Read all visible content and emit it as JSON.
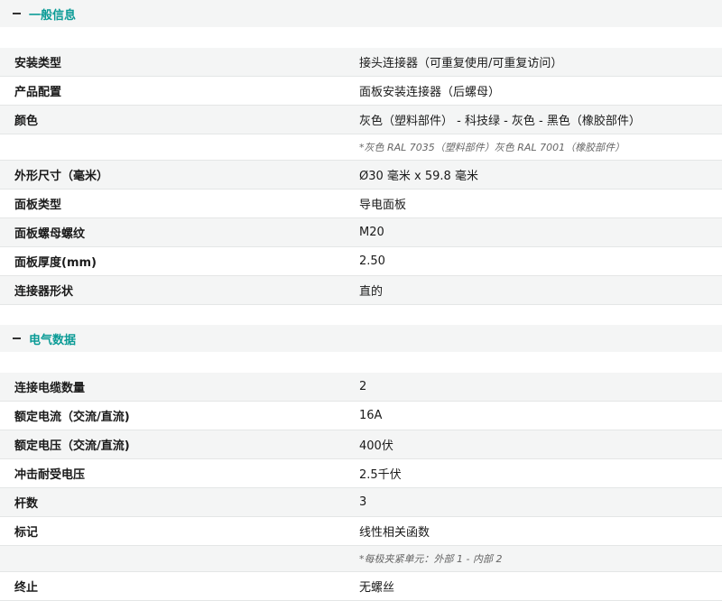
{
  "general": {
    "title": "一般信息",
    "rows": [
      {
        "label": "安装类型",
        "value": "接头连接器（可重复使用/可重复访问）"
      },
      {
        "label": "产品配置",
        "value": "面板安装连接器（后螺母）"
      },
      {
        "label": "颜色",
        "value": "灰色（塑料部件） - 科技绿 - 灰色 - 黑色（橡胶部件）"
      },
      {
        "label": "",
        "value": "*灰色 RAL 7035（塑料部件）灰色 RAL 7001（橡胶部件）"
      },
      {
        "label": "外形尺寸（毫米）",
        "value": "Ø30 毫米 x 59.8 毫米"
      },
      {
        "label": "面板类型",
        "value": "导电面板"
      },
      {
        "label": "面板螺母螺纹",
        "value": "M20"
      },
      {
        "label": "面板厚度(mm)",
        "value": "2.50"
      },
      {
        "label": "连接器形状",
        "value": "直的"
      }
    ]
  },
  "electrical": {
    "title": "电气数据",
    "rows": [
      {
        "label": "连接电缆数量",
        "value": "2"
      },
      {
        "label": "额定电流（交流/直流)",
        "value": "16A"
      },
      {
        "label": "额定电压（交流/直流)",
        "value": "400伏"
      },
      {
        "label": "冲击耐受电压",
        "value": "2.5千伏"
      },
      {
        "label": "杆数",
        "value": "3"
      },
      {
        "label": "标记",
        "value": "线性相关函数"
      },
      {
        "label": "",
        "value": "*每极夹紧单元：外部 1 - 内部 2"
      },
      {
        "label": "终止",
        "value": "无螺丝"
      }
    ]
  }
}
